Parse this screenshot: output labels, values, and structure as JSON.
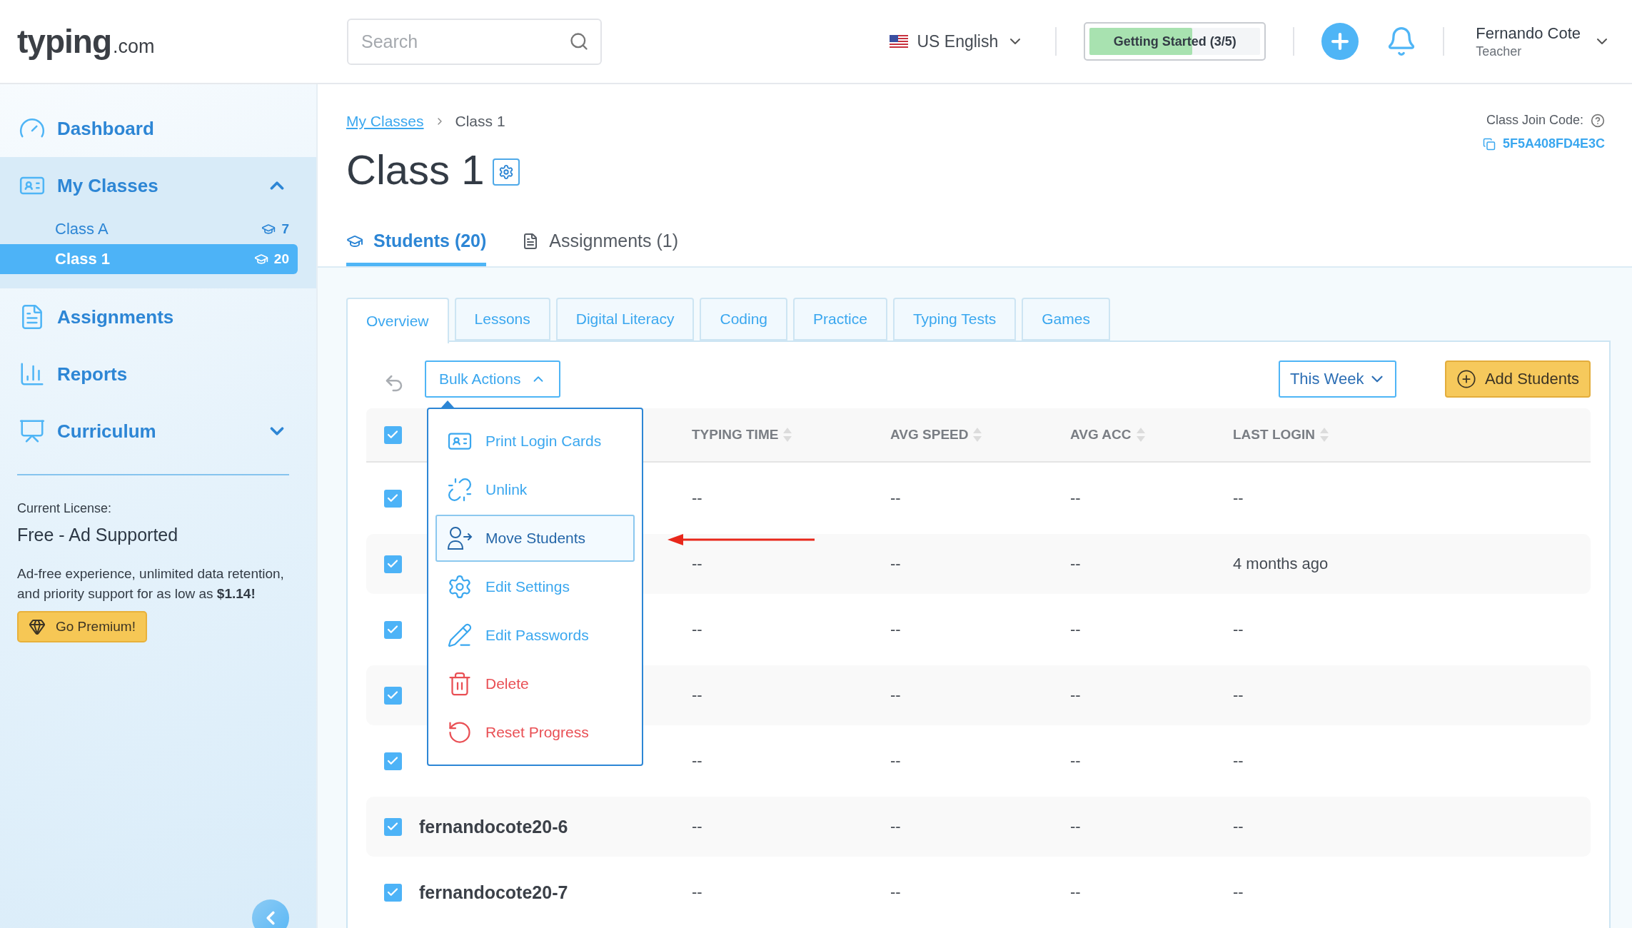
{
  "header": {
    "logo": {
      "main": "typing",
      "suffix": ".com"
    },
    "search": {
      "placeholder": "Search"
    },
    "language": "US English",
    "progress": {
      "label": "Getting Started (3/5)",
      "level": 0.6
    },
    "user": {
      "name": "Fernando Cote",
      "role": "Teacher"
    }
  },
  "sidebar": {
    "items": [
      {
        "label": "Dashboard"
      },
      {
        "label": "My Classes",
        "expanded": true,
        "children": [
          {
            "label": "Class A",
            "count": "7",
            "selected": false
          },
          {
            "label": "Class 1",
            "count": "20",
            "selected": true
          }
        ]
      },
      {
        "label": "Assignments"
      },
      {
        "label": "Reports"
      },
      {
        "label": "Curriculum",
        "expanded": false
      }
    ],
    "license": {
      "label": "Current License:",
      "plan": "Free - Ad Supported",
      "text": "Ad-free experience, unlimited data retention, and priority support for as low as **$1.14!**",
      "button": "Go Premium!"
    }
  },
  "main": {
    "breadcrumb": [
      "My Classes",
      "Class 1"
    ],
    "title": "Class 1",
    "join_code": {
      "label": "Class Join Code:",
      "code": "5F5A408FD4E3C"
    },
    "tabs": [
      {
        "label": "Students (20)",
        "selected": true
      },
      {
        "label": "Assignments (1)",
        "selected": false
      }
    ],
    "subtabs": [
      {
        "label": "Overview",
        "selected": true
      },
      {
        "label": "Lessons",
        "selected": false
      },
      {
        "label": "Digital Literacy",
        "selected": false
      },
      {
        "label": "Coding",
        "selected": false
      },
      {
        "label": "Practice",
        "selected": false
      },
      {
        "label": "Typing Tests",
        "selected": false
      },
      {
        "label": "Games",
        "selected": false
      }
    ],
    "toolbar": {
      "bulk_actions": {
        "label": "Bulk Actions",
        "expanded": true
      },
      "period": "This Week",
      "add_button": "Add Students"
    },
    "bulk_menu": [
      {
        "label": "Print Login Cards",
        "kind": "normal",
        "selected": false
      },
      {
        "label": "Unlink",
        "kind": "normal",
        "selected": false
      },
      {
        "label": "Move Students",
        "kind": "normal",
        "selected": true
      },
      {
        "label": "Edit Settings",
        "kind": "normal",
        "selected": false
      },
      {
        "label": "Edit Passwords",
        "kind": "normal",
        "selected": false
      },
      {
        "label": "Delete",
        "kind": "danger",
        "selected": false
      },
      {
        "label": "Reset Progress",
        "kind": "danger",
        "selected": false
      }
    ],
    "table": {
      "all_checked": true,
      "columns": [
        "TYPING TIME",
        "AVG SPEED",
        "AVG ACC",
        "LAST LOGIN"
      ],
      "rows": [
        {
          "checked": true,
          "cells": [
            "--",
            "--",
            "--",
            "--"
          ]
        },
        {
          "checked": true,
          "cells": [
            "--",
            "--",
            "--",
            "4 months ago"
          ]
        },
        {
          "checked": true,
          "cells": [
            "--",
            "--",
            "--",
            "--"
          ]
        },
        {
          "checked": true,
          "cells": [
            "--",
            "--",
            "--",
            "--"
          ]
        },
        {
          "checked": true,
          "cells": [
            "--",
            "--",
            "--",
            "--"
          ]
        },
        {
          "checked": true,
          "name": "fernandocote20-6",
          "cells": [
            "--",
            "--",
            "--",
            "--"
          ]
        },
        {
          "checked": true,
          "name": "fernandocote20-7",
          "cells": [
            "--",
            "--",
            "--",
            "--"
          ]
        }
      ]
    }
  }
}
